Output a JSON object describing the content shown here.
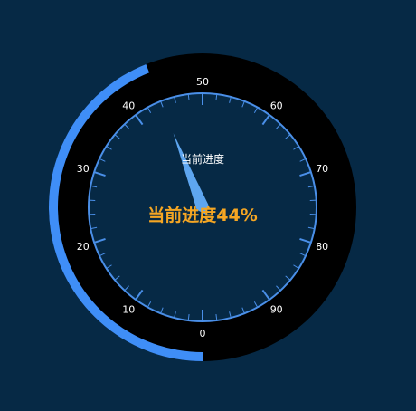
{
  "chart_data": {
    "type": "gauge",
    "value": 44,
    "min": 0,
    "max": 100,
    "series_name": "当前进度",
    "detail_label": "当前进度44%",
    "tick_labels": [
      "0",
      "10",
      "20",
      "30",
      "40",
      "50",
      "60",
      "70",
      "80",
      "90"
    ],
    "colors": {
      "background": "#062945",
      "outer_ring_track": "#000000",
      "progress": "#3f8ef7",
      "axis_line": "#4a8fe8",
      "pointer": "#5ea6f0",
      "tick_label": "#ffffff",
      "series_label": "#ffffff",
      "detail": "#f5a623"
    }
  }
}
